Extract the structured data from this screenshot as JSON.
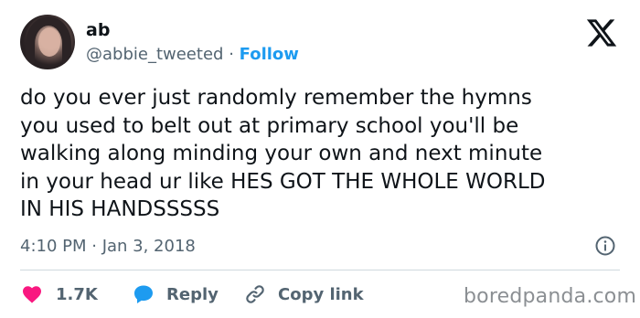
{
  "user": {
    "display_name": "ab",
    "handle": "@abbie_tweeted",
    "separator": "·",
    "follow_label": "Follow"
  },
  "tweet": {
    "text": "do you ever just randomly remember the hymns\nyou used to belt out at primary school you'll be\nwalking along minding your own and next minute\nin your head ur like HES GOT THE WHOLE WORLD\nIN HIS HANDSSSSS",
    "timestamp": "4:10 PM · Jan 3, 2018"
  },
  "actions": {
    "like_count": "1.7K",
    "reply_label": "Reply",
    "copy_link_label": "Copy link"
  },
  "watermark": "boredpanda.com",
  "icons": {
    "platform": "x-logo-icon",
    "info": "info-icon",
    "like": "heart-icon",
    "reply": "speech-bubble-icon",
    "link": "link-icon"
  },
  "colors": {
    "text": "#0f1419",
    "muted": "#536471",
    "accent": "#1d9bf0",
    "like": "#f91880",
    "divider": "#cfd9de"
  }
}
